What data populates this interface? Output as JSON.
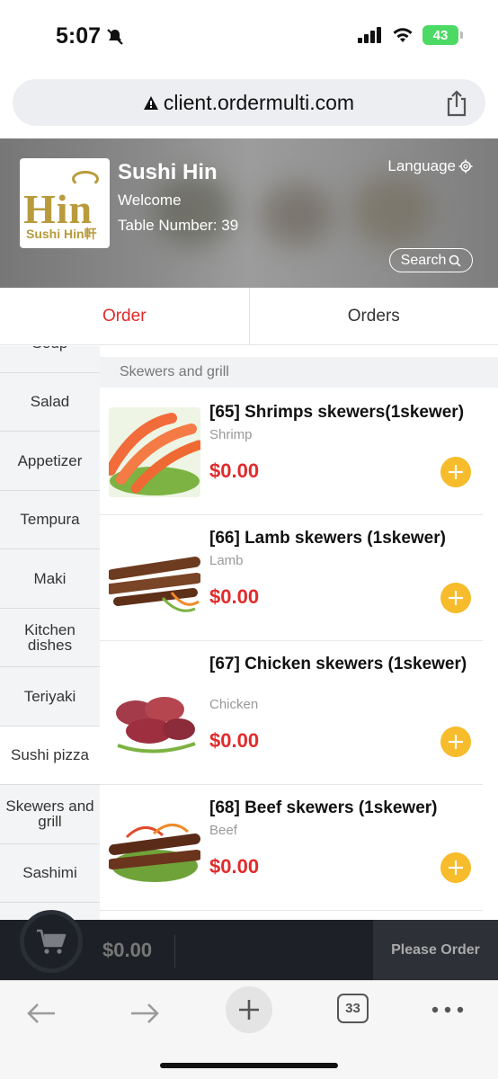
{
  "status_bar": {
    "time": "5:07",
    "battery": "43"
  },
  "browser": {
    "url": "client.ordermulti.com",
    "tab_count": "33"
  },
  "restaurant": {
    "name": "Sushi Hin",
    "welcome": "Welcome",
    "table": "Table Number: 39",
    "language_label": "Language",
    "search_label": "Search",
    "logo_text": "Hin",
    "logo_sub": "Sushi Hin軒"
  },
  "tabs": [
    {
      "label": "Order"
    },
    {
      "label": "Orders"
    }
  ],
  "sidebar": {
    "items": [
      {
        "label": "Soup"
      },
      {
        "label": "Salad"
      },
      {
        "label": "Appetizer"
      },
      {
        "label": "Tempura"
      },
      {
        "label": "Maki"
      },
      {
        "label": "Kitchen dishes"
      },
      {
        "label": "Teriyaki"
      },
      {
        "label": "Sushi pizza"
      },
      {
        "label": "Skewers and grill"
      },
      {
        "label": "Sashimi"
      }
    ]
  },
  "section": {
    "title": "Skewers and grill"
  },
  "dishes": [
    {
      "name": "[65] Shrimps skewers(1skewer)",
      "desc": "Shrimp",
      "price": "$0.00"
    },
    {
      "name": "[66] Lamb skewers (1skewer)",
      "desc": "Lamb",
      "price": "$0.00"
    },
    {
      "name": "[67] Chicken skewers (1skewer)",
      "desc": "Chicken",
      "price": "$0.00"
    },
    {
      "name": "[68] Beef skewers (1skewer)",
      "desc": "Beef",
      "price": "$0.00"
    }
  ],
  "cart": {
    "total": "$0.00",
    "button": "Please Order"
  },
  "colors": {
    "accent_red": "#e12b2b",
    "add_yellow": "#f6bc2b",
    "cart_bg": "#1d2026"
  }
}
